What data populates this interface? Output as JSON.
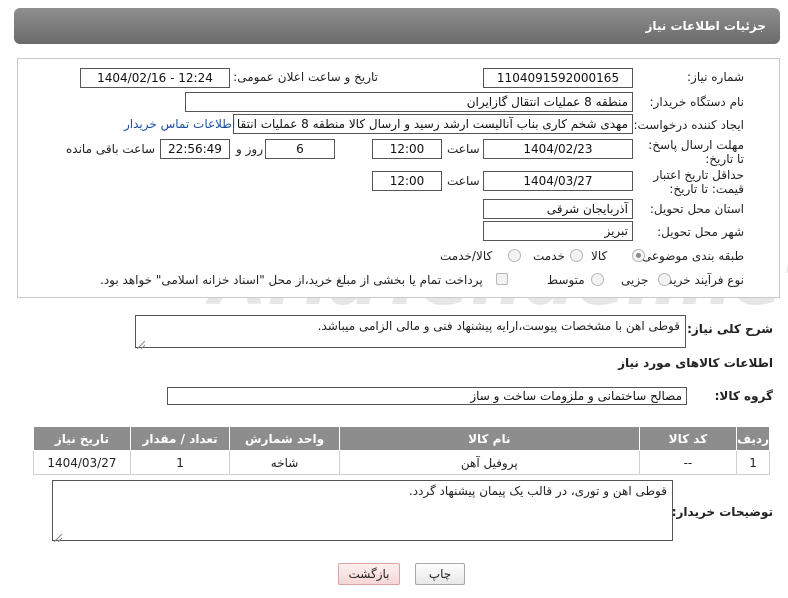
{
  "header": {
    "title": "جزئیات اطلاعات نیاز"
  },
  "fields": {
    "need_number_label": "شماره نیاز:",
    "need_number": "1104091592000165",
    "announce_label": "تاریخ و ساعت اعلان عمومی:",
    "announce_value": "1404/02/16 - 12:24",
    "buyer_org_label": "نام دستگاه خریدار:",
    "buyer_org": "منطقه 8 عملیات انتقال گازایران",
    "creator_label": "ایجاد کننده درخواست:",
    "creator": "مهدی شخم کاری بناب آنالیست ارشد رسید و ارسال کالا منطقه 8 عملیات انتقا",
    "contact_link": "اطلاعات تماس خریدار",
    "deadline_label": "مهلت ارسال پاسخ: تا تاریخ:",
    "deadline_date": "1404/02/23",
    "time_label": "ساعت",
    "deadline_time": "12:00",
    "days_value": "6",
    "days_label": "روز و",
    "remaining_value": "22:56:49",
    "remaining_label": "ساعت باقی مانده",
    "price_valid_label": "حداقل تاریخ اعتبار قیمت: تا تاریخ:",
    "price_valid_date": "1404/03/27",
    "price_valid_time": "12:00",
    "province_label": "استان محل تحویل:",
    "province": "آذربایجان شرقی",
    "city_label": "شهر محل تحویل:",
    "city": "تبریز",
    "category_label": "طبقه بندی موضوعی:",
    "category_options": [
      "کالا",
      "خدمت",
      "کالا/خدمت"
    ],
    "process_label": "نوع فرآیند خرید :",
    "process_options": [
      "جزیی",
      "متوسط"
    ],
    "payment_note": "پرداخت تمام یا بخشی از مبلغ خرید،از محل \"اسناد خزانه اسلامی\" خواهد بود."
  },
  "description": {
    "label": "شرح کلی نیاز:",
    "text": "قوطی اهن با مشخصات پیوست،ارایه پیشنهاد فنی و مالی الزامی میباشد."
  },
  "goods_section": {
    "title": "اطلاعات کالاهای مورد نیاز",
    "group_label": "گروه کالا:",
    "group_value": "مصالح ساختمانی و ملزومات ساخت و ساز"
  },
  "table": {
    "headers": [
      "ردیف",
      "کد کالا",
      "نام کالا",
      "واحد شمارش",
      "تعداد / مقدار",
      "تاریخ نیاز"
    ],
    "rows": [
      [
        "1",
        "--",
        "پروفیل آهن",
        "شاخه",
        "1",
        "1404/03/27"
      ]
    ]
  },
  "buyer_notes": {
    "label": "توضیحات خریدار:",
    "text": "قوطی اهن و توری، در قالب یک پیمان پیشنهاد گردد."
  },
  "buttons": {
    "print": "چاپ",
    "back": "بازگشت"
  }
}
